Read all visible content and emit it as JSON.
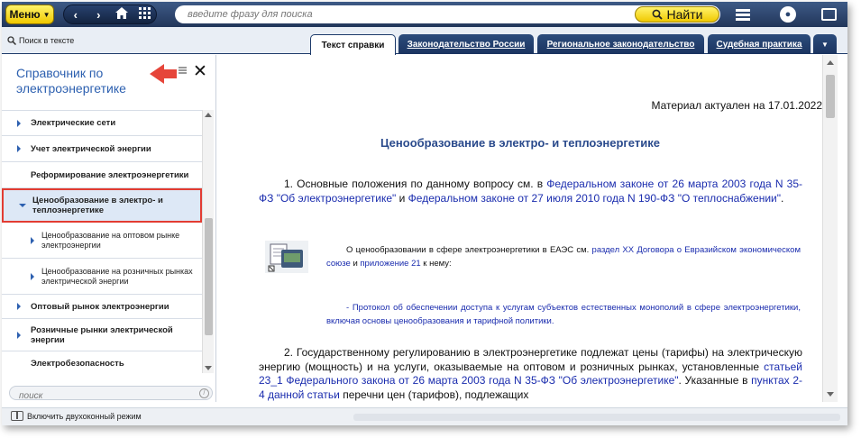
{
  "toolbar": {
    "menu_label": "Меню",
    "search_placeholder": "введите фразу для поиска",
    "search_button": "Найти"
  },
  "subbar": {
    "search_in_text": "Поиск в тексте",
    "tabs": [
      {
        "label": "Текст справки",
        "active": true
      },
      {
        "label": "Законодательство России",
        "active": false
      },
      {
        "label": "Региональное законодательство",
        "active": false
      },
      {
        "label": "Судебная практика",
        "active": false
      }
    ]
  },
  "sidebar": {
    "title": "Справочник по электроэнергетике",
    "items": [
      {
        "label": "Электрические сети",
        "level": 1,
        "expandable": true
      },
      {
        "label": "Учет электрической энергии",
        "level": 1,
        "expandable": true
      },
      {
        "label": "Реформирование электроэнергетики",
        "level": 1,
        "expandable": false
      },
      {
        "label": "Ценообразование в электро- и теплоэнергетике",
        "level": 1,
        "expandable": true,
        "expanded": true,
        "selected": true
      },
      {
        "label": "Ценообразование на оптовом рынке электроэнергии",
        "level": 2,
        "expandable": true
      },
      {
        "label": "Ценообразование на розничных рынках электрической энергии",
        "level": 2,
        "expandable": true
      },
      {
        "label": "Оптовый рынок электроэнергии",
        "level": 1,
        "expandable": true
      },
      {
        "label": "Розничные рынки электрической энергии",
        "level": 1,
        "expandable": true
      },
      {
        "label": "Электробезопасность",
        "level": 1,
        "expandable": false
      }
    ],
    "search_placeholder": "поиск"
  },
  "document": {
    "actual_note": "Материал актуален на 17.01.2022",
    "title": "Ценообразование в электро- и теплоэнергетике",
    "p1": {
      "t1": "1. Основные положения по данному вопросу см. в ",
      "l1": "Федеральном законе от 26 марта 2003 года N 35-ФЗ \"Об электроэнергетике\"",
      "t2": " и ",
      "l2": "Федеральном законе от 27 июля 2010 года N 190-ФЗ \"О теплоснабжении\"",
      "t3": "."
    },
    "p2": {
      "t1": "О ценообразовании в сфере электроэнергетики в ЕАЭС см. ",
      "l1": "раздел XX Договора о Евразийском экономическом союзе",
      "t2": " и ",
      "l2": "приложение 21",
      "t3": " к нему:"
    },
    "p3": "- Протокол об обеспечении доступа к услугам субъектов естественных монополий в сфере электроэнергетики, включая основы ценообразования и тарифной политики.",
    "p4": {
      "t1": "2. Государственному регулированию в электроэнергетике подлежат цены (тарифы) на электрическую энергию (мощность) и на услуги, оказываемые на оптовом и розничных рынках, установленные ",
      "l1": "статьей 23_1 Федерального закона от 26 марта 2003 года N 35-ФЗ \"Об электроэнергетике\"",
      "t2": ". Указанные в ",
      "l2": "пунктах 2-4 данной статьи",
      "t3": " перечни цен (тарифов), подлежащих"
    }
  },
  "statusbar": {
    "two_window_label": "Включить двухоконный режим"
  },
  "colors": {
    "toolbar": "#22365a",
    "accent_yellow": "#f0c800",
    "link": "#1a2cae",
    "highlight_border": "#e23c32",
    "sidebar_title": "#2d60b0"
  }
}
